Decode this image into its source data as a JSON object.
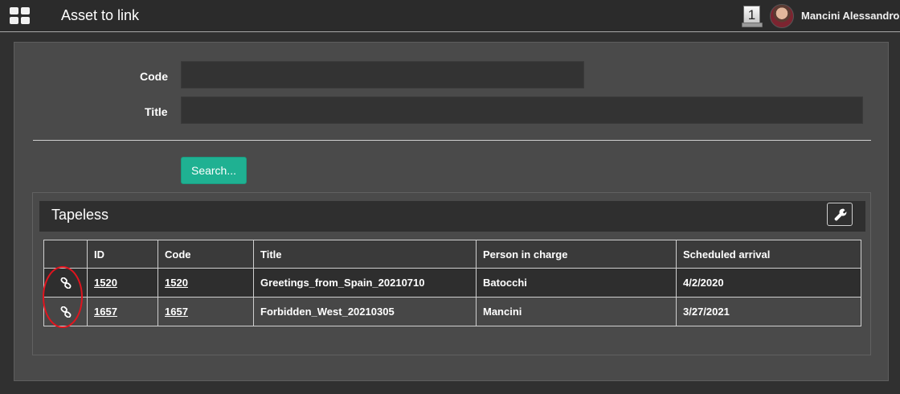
{
  "header": {
    "title": "Asset to link",
    "notification_count": "1",
    "user_name": "Mancini Alessandro",
    "apps_icon": "grid-icon",
    "dropdown_icon": "chevron-down-icon"
  },
  "form": {
    "code_label": "Code",
    "code_value": "",
    "title_label": "Title",
    "title_value": "",
    "search_label": "Search..."
  },
  "tapeless": {
    "title": "Tapeless",
    "tool_icon": "wrench-icon",
    "columns": [
      "",
      "ID",
      "Code",
      "Title",
      "Person in charge",
      "Scheduled arrival"
    ],
    "rows": [
      {
        "id": "1520",
        "code": "1520",
        "title": "Greetings_from_Spain_20210710",
        "person": "Batocchi",
        "arrival": "4/2/2020"
      },
      {
        "id": "1657",
        "code": "1657",
        "title": "Forbidden_West_20210305",
        "person": "Mancini",
        "arrival": "3/27/2021"
      }
    ]
  },
  "colors": {
    "accent": "#1fb192",
    "highlight": "#e0141e"
  }
}
